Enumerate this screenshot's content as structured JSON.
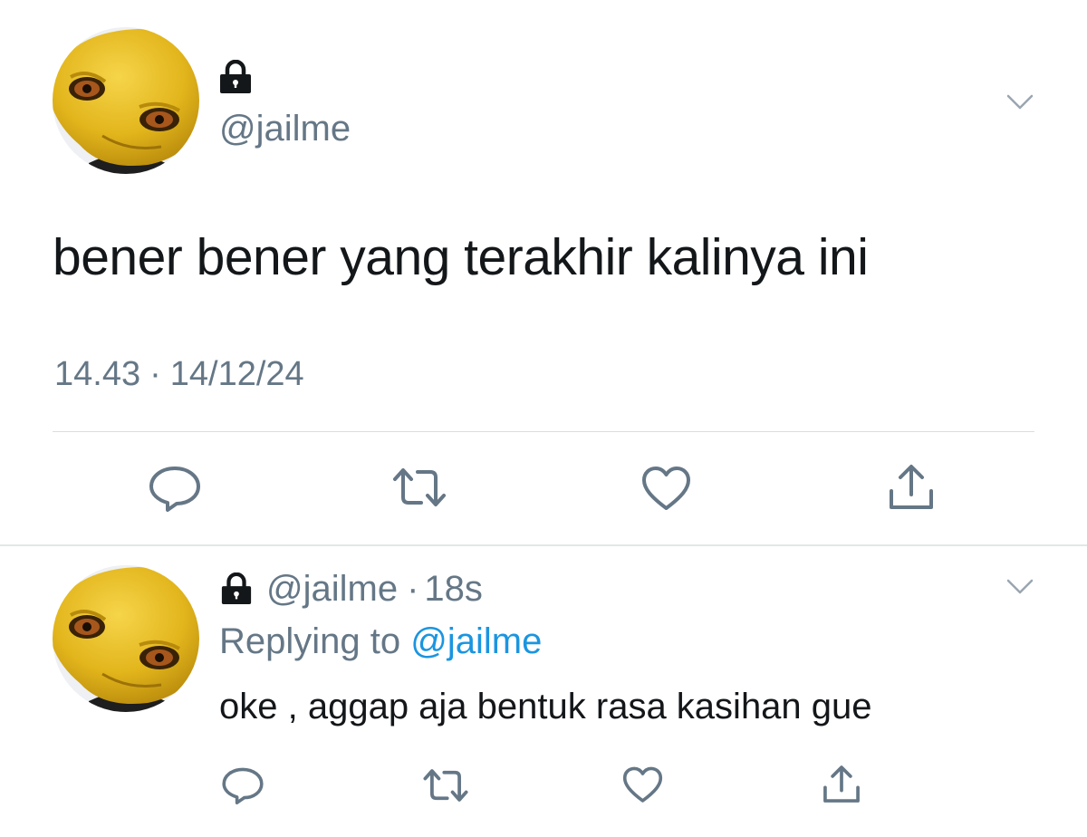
{
  "main_tweet": {
    "locked": true,
    "handle": "@jailme",
    "text": "bener bener yang terakhir kalinya ini",
    "time": "14.43",
    "separator": "·",
    "date": "14/12/24"
  },
  "reply_tweet": {
    "locked": true,
    "handle": "@jailme",
    "separator": "·",
    "age": "18s",
    "replying_prefix": "Replying to",
    "replying_to": "@jailme",
    "text": "oke , aggap aja bentuk rasa kasihan gue"
  },
  "icons": {
    "reply": "comment-bubble-icon",
    "retweet": "retweet-icon",
    "like": "heart-icon",
    "share": "share-icon",
    "lock": "lock-icon",
    "menu": "chevron-down-icon"
  },
  "colors": {
    "text_primary": "#14171a",
    "text_secondary": "#657786",
    "link": "#1b95e0",
    "icon": "#657786",
    "divider": "#e3e7ea"
  }
}
